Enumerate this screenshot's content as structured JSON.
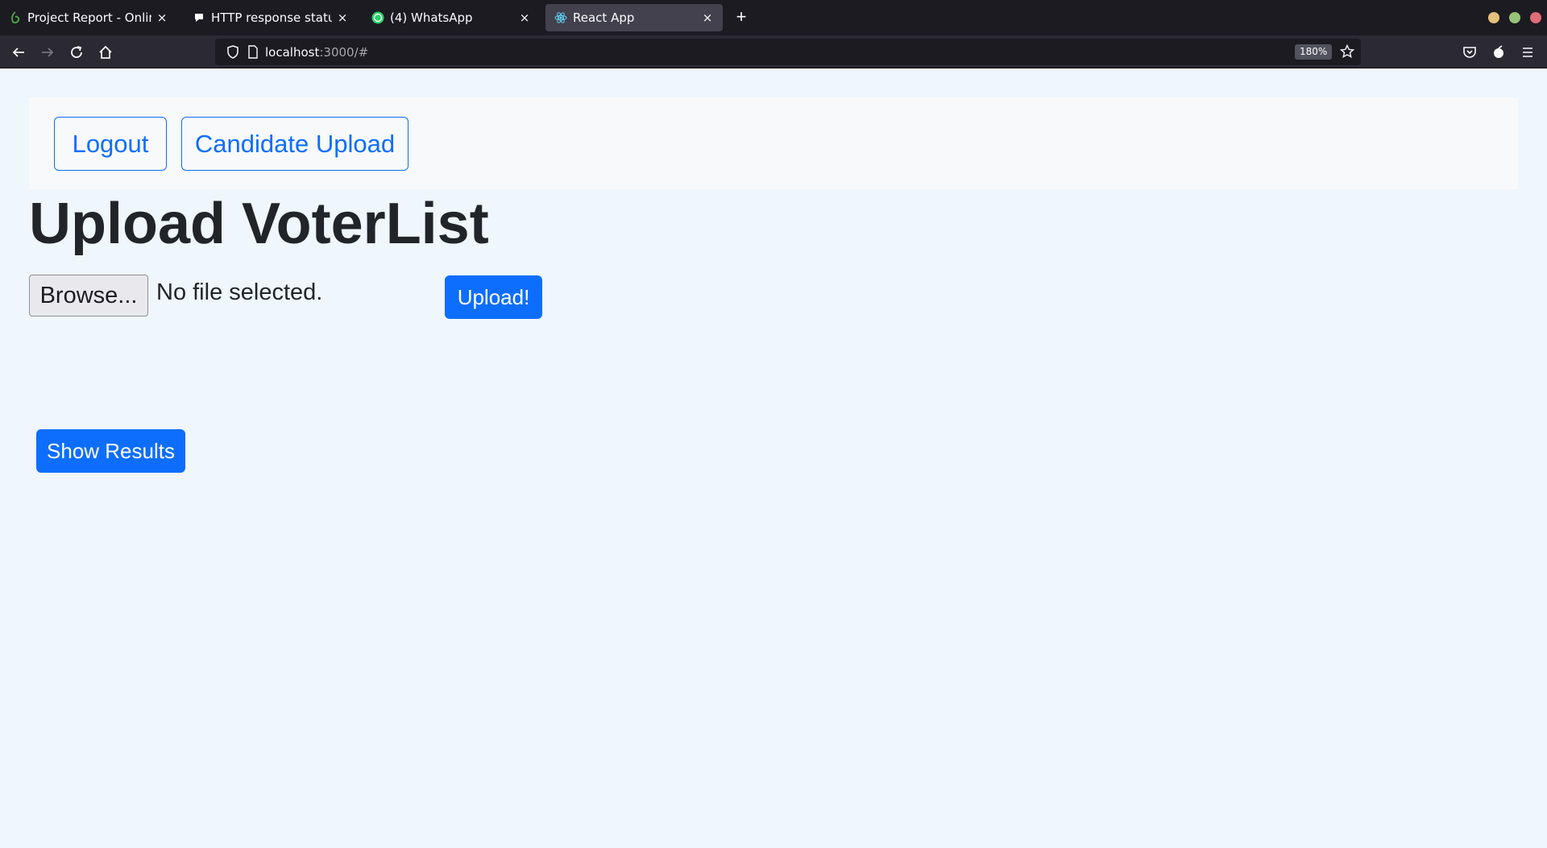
{
  "browser": {
    "tabs": [
      {
        "title": "Project Report - Online LaTeX",
        "icon": "overleaf-icon",
        "active": false
      },
      {
        "title": "HTTP response status codes",
        "icon": "mdn-icon",
        "active": false
      },
      {
        "title": "(4) WhatsApp",
        "icon": "whatsapp-icon",
        "active": false
      },
      {
        "title": "React App",
        "icon": "react-icon",
        "active": true
      }
    ],
    "close_glyph": "×",
    "new_tab_glyph": "+",
    "url_host": "localhost",
    "url_path": ":3000/#",
    "zoom": "180%"
  },
  "nav": {
    "logout_label": "Logout",
    "candidate_upload_label": "Candidate Upload"
  },
  "main": {
    "title": "Upload VoterList",
    "browse_label": "Browse...",
    "file_status": "No file selected.",
    "upload_label": "Upload!",
    "show_results_label": "Show Results"
  },
  "colors": {
    "primary": "#0d6efd",
    "page_bg": "#eff6fc",
    "nav_bg": "#f8f9fa",
    "text": "#212529"
  }
}
